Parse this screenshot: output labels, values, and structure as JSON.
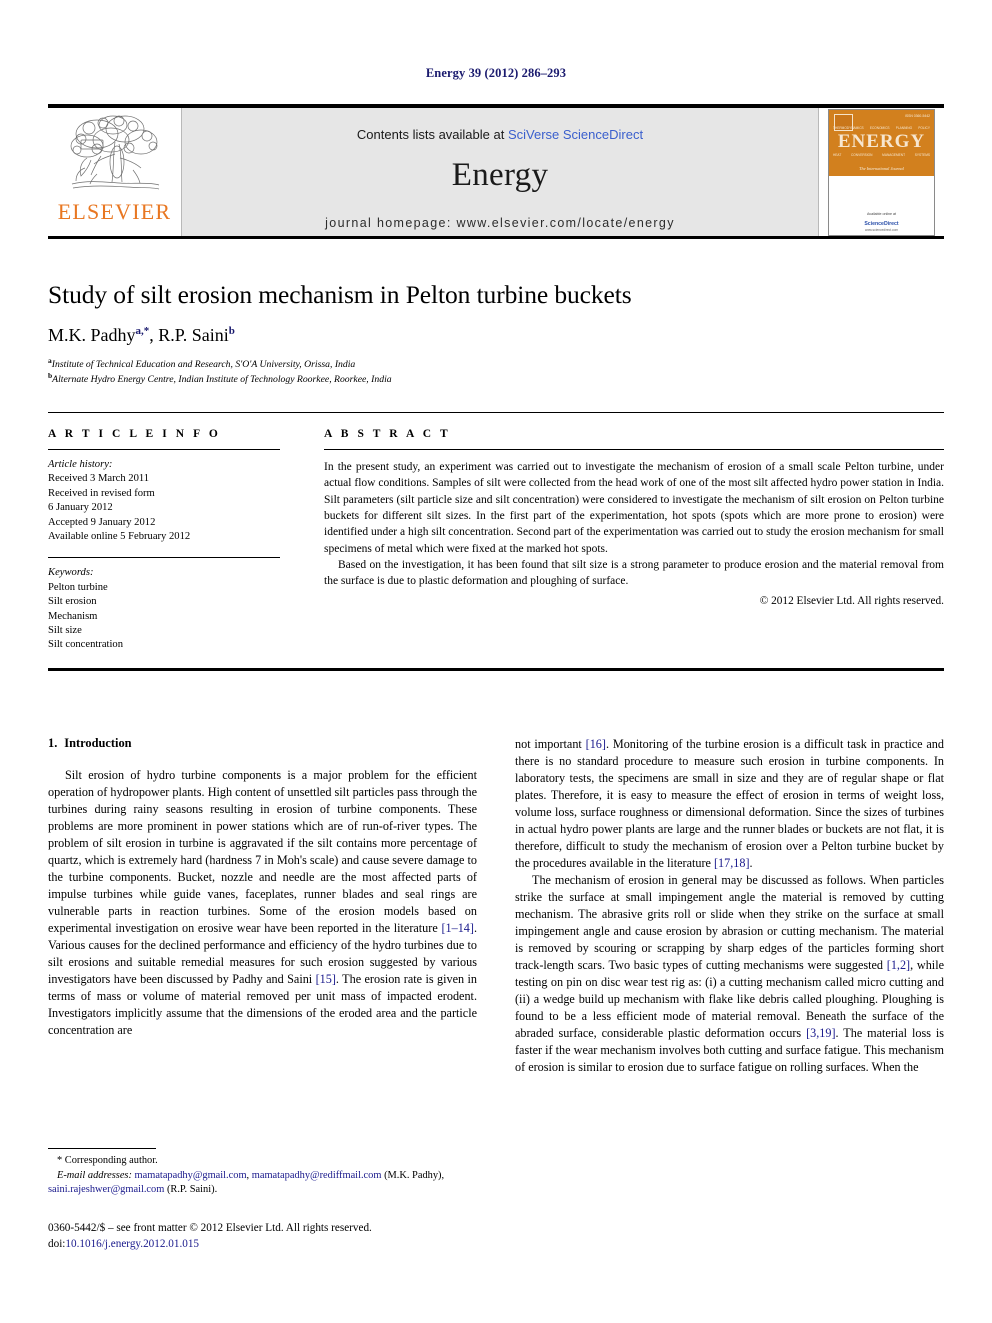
{
  "running_head": "Energy 39 (2012) 286–293",
  "masthead": {
    "publisher_name": "ELSEVIER",
    "contents_prefix": "Contents lists available at ",
    "contents_link": "SciVerse ScienceDirect",
    "journal_name": "Energy",
    "homepage_line": "journal homepage: www.elsevier.com/locate/energy",
    "cover": {
      "title": "ENERGY",
      "subtitle": "The International Journal",
      "top_right": "ISSN 0360-5442",
      "keywords_top": [
        "THERMODYNAMICS",
        "ECONOMICS",
        "PLANNING",
        "POLICY"
      ],
      "keywords_bottom": [
        "HEAT",
        "CONVERSION",
        "MANAGEMENT",
        "SYSTEMS"
      ],
      "available_online": "Available online at",
      "sciencedirect": "ScienceDirect",
      "sd_url": "www.sciencedirect.com"
    }
  },
  "article": {
    "title": "Study of silt erosion mechanism in Pelton turbine buckets",
    "authors": "M.K. Padhy, R.P. Saini",
    "author_list": [
      {
        "name": "M.K. Padhy",
        "marks": "a,*"
      },
      {
        "name": "R.P. Saini",
        "marks": "b"
      }
    ],
    "affiliations": [
      {
        "mark": "a",
        "text": "Institute of Technical Education and Research, S'O'A University, Orissa, India"
      },
      {
        "mark": "b",
        "text": "Alternate Hydro Energy Centre, Indian Institute of Technology Roorkee, Roorkee, India"
      }
    ]
  },
  "article_info": {
    "heading": "A R T I C L E  I N F O",
    "history_title": "Article history:",
    "history": [
      "Received 3 March 2011",
      "Received in revised form",
      "6 January 2012",
      "Accepted 9 January 2012",
      "Available online 5 February 2012"
    ],
    "keywords_title": "Keywords:",
    "keywords": [
      "Pelton turbine",
      "Silt erosion",
      "Mechanism",
      "Silt size",
      "Silt concentration"
    ]
  },
  "abstract": {
    "heading": "A B S T R A C T",
    "paragraphs": [
      "In the present study, an experiment was carried out to investigate the mechanism of erosion of a small scale Pelton turbine, under actual flow conditions. Samples of silt were collected from the head work of one of the most silt affected hydro power station in India. Silt parameters (silt particle size and silt concentration) were considered to investigate the mechanism of silt erosion on Pelton turbine buckets for different silt sizes. In the first part of the experimentation, hot spots (spots which are more prone to erosion) were identified under a high silt concentration. Second part of the experimentation was carried out to study the erosion mechanism for small specimens of metal which were fixed at the marked hot spots.",
      "Based on the investigation, it has been found that silt size is a strong parameter to produce erosion and the material removal from the surface is due to plastic deformation and ploughing of surface."
    ],
    "copyright": "© 2012 Elsevier Ltd. All rights reserved."
  },
  "body": {
    "section_number": "1.",
    "section_title": "Introduction",
    "left_column": [
      "Silt erosion of hydro turbine components is a major problem for the efficient operation of hydropower plants. High content of unsettled silt particles pass through the turbines during rainy seasons resulting in erosion of turbine components. These problems are more prominent in power stations which are of run-of-river types. The problem of silt erosion in turbine is aggravated if the silt contains more percentage of quartz, which is extremely hard (hardness 7 in Moh's scale) and cause severe damage to the turbine components. Bucket, nozzle and needle are the most affected parts of impulse turbines while guide vanes, faceplates, runner blades and seal rings are vulnerable parts in reaction turbines. Some of the erosion models based on experimental investigation on erosive wear have been reported in the literature [1–14]. Various causes for the declined performance and efficiency of the hydro turbines due to silt erosions and suitable remedial measures for such erosion suggested by various investigators have been discussed by Padhy and Saini [15]. The erosion rate is given in terms of mass or volume of material removed per unit mass of impacted erodent. Investigators implicitly assume that the dimensions of the eroded area and the particle concentration are"
    ],
    "right_column": [
      "not important [16]. Monitoring of the turbine erosion is a difficult task in practice and there is no standard procedure to measure such erosion in turbine components. In laboratory tests, the specimens are small in size and they are of regular shape or flat plates. Therefore, it is easy to measure the effect of erosion in terms of weight loss, volume loss, surface roughness or dimensional deformation. Since the sizes of turbines in actual hydro power plants are large and the runner blades or buckets are not flat, it is therefore, difficult to study the mechanism of erosion over a Pelton turbine bucket by the procedures available in the literature [17,18].",
      "The mechanism of erosion in general may be discussed as follows. When particles strike the surface at small impingement angle the material is removed by cutting mechanism. The abrasive grits roll or slide when they strike on the surface at small impingement angle and cause erosion by abrasion or cutting mechanism. The material is removed by scouring or scrapping by sharp edges of the particles forming short track-length scars. Two basic types of cutting mechanisms were suggested [1,2], while testing on pin on disc wear test rig as: (i) a cutting mechanism called micro cutting and (ii) a wedge build up mechanism with flake like debris called ploughing. Ploughing is found to be a less efficient mode of material removal. Beneath the surface of the abraded surface, considerable plastic deformation occurs [3,19]. The material loss is faster if the wear mechanism involves both cutting and surface fatigue. This mechanism of erosion is similar to erosion due to surface fatigue on rolling surfaces. When the"
    ]
  },
  "footnote": {
    "corresponding": "* Corresponding author.",
    "email_label": "E-mail addresses:",
    "emails": [
      "mamatapadhy@gmail.com",
      "mamatapadhy@rediffmail.com",
      "saini.rajeshwer@gmail.com"
    ],
    "email_line_1_suffix": ", ",
    "author_1": "(M.K. Padhy)",
    "author_2": "(R.P. Saini)."
  },
  "imprint": {
    "line1": "0360-5442/$ – see front matter © 2012 Elsevier Ltd. All rights reserved.",
    "doi_label": "doi:",
    "doi": "10.1016/j.energy.2012.01.015"
  },
  "colors": {
    "running_head": "#1a1a6e",
    "link_blue": "#3a5fcd",
    "reference_blue": "#1a1a8c",
    "elsevier_orange": "#E87722",
    "masthead_grey": "#e6e6e6",
    "cover_orange": "#D2801E"
  }
}
